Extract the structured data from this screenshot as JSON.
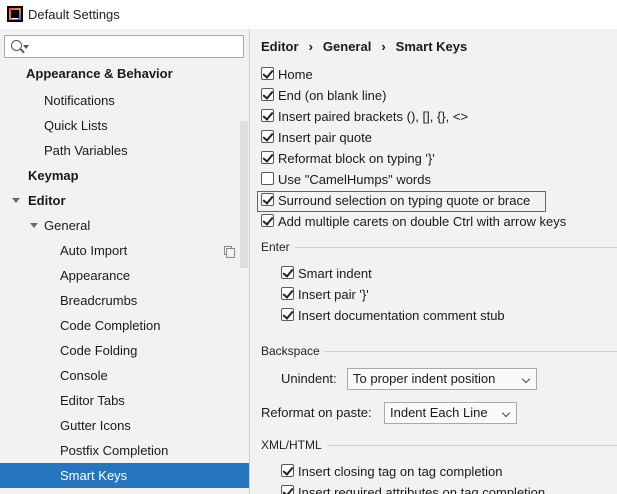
{
  "window": {
    "title": "Default Settings"
  },
  "search": {
    "placeholder": ""
  },
  "sidebar": {
    "items": [
      {
        "label": "Appearance & Behavior"
      },
      {
        "label": "Notifications"
      },
      {
        "label": "Quick Lists"
      },
      {
        "label": "Path Variables"
      },
      {
        "label": "Keymap"
      },
      {
        "label": "Editor"
      },
      {
        "label": "General"
      },
      {
        "label": "Auto Import"
      },
      {
        "label": "Appearance"
      },
      {
        "label": "Breadcrumbs"
      },
      {
        "label": "Code Completion"
      },
      {
        "label": "Code Folding"
      },
      {
        "label": "Console"
      },
      {
        "label": "Editor Tabs"
      },
      {
        "label": "Gutter Icons"
      },
      {
        "label": "Postfix Completion"
      },
      {
        "label": "Smart Keys"
      }
    ],
    "selected": "Smart Keys"
  },
  "breadcrumb": {
    "part1": "Editor",
    "part2": "General",
    "part3": "Smart Keys",
    "separator": "›"
  },
  "options": [
    {
      "label": "Home",
      "checked": true
    },
    {
      "label": "End (on blank line)",
      "checked": true
    },
    {
      "label": "Insert paired brackets (), [], {}, <>",
      "checked": true
    },
    {
      "label": "Insert pair quote",
      "checked": true
    },
    {
      "label": "Reformat block on typing '}'",
      "checked": true
    },
    {
      "label": "Use \"CamelHumps\" words",
      "checked": false
    },
    {
      "label": "Surround selection on typing quote or brace",
      "checked": true
    },
    {
      "label": "Add multiple carets on double Ctrl with arrow keys",
      "checked": true
    }
  ],
  "enter": {
    "title": "Enter",
    "options": [
      {
        "label": "Smart indent",
        "checked": true
      },
      {
        "label": "Insert pair '}'",
        "checked": true
      },
      {
        "label": "Insert documentation comment stub",
        "checked": true
      }
    ]
  },
  "backspace": {
    "title": "Backspace",
    "unindent_label": "Unindent:",
    "unindent_value": "To proper indent position"
  },
  "reformat": {
    "label": "Reformat on paste:",
    "value": "Indent Each Line"
  },
  "xml": {
    "title": "XML/HTML",
    "options": [
      {
        "label": "Insert closing tag on tag completion",
        "checked": true
      },
      {
        "label": "Insert required attributes on tag completion",
        "checked": true
      }
    ]
  },
  "colors": {
    "selection": "#2675bf",
    "highlight": "#e03030"
  }
}
